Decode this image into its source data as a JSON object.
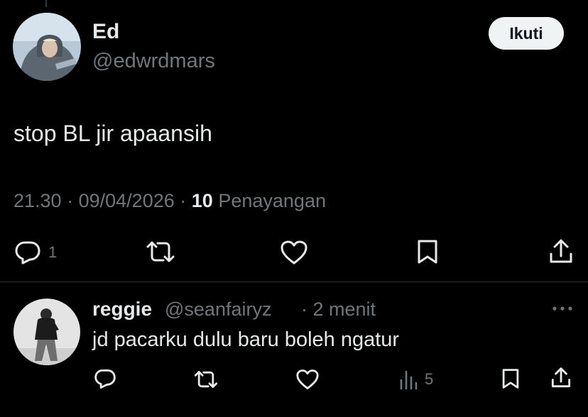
{
  "tweet": {
    "author": {
      "name": "Ed",
      "handle": "@edwrdmars"
    },
    "follow_label": "Ikuti",
    "text": "stop BL jir apaansih",
    "time": "21.30",
    "date": "09/04/2026",
    "separator": "·",
    "view_count": "10",
    "view_label": "Penayangan",
    "stats": {
      "replies": "1"
    },
    "icons": [
      "reply-icon",
      "retweet-icon",
      "like-icon",
      "bookmark-icon",
      "share-icon"
    ]
  },
  "reply": {
    "author": {
      "name": "reggie",
      "handle": "@seanfairyz",
      "time": "· 2 menit"
    },
    "text": "jd pacarku dulu baru boleh ngatur",
    "stats": {
      "views": "5"
    },
    "icons": [
      "reply-icon",
      "retweet-icon",
      "like-icon",
      "views-icon",
      "bookmark-icon",
      "share-icon",
      "more-icon"
    ]
  },
  "colors": {
    "background": "#000000",
    "text": "#e7e9ea",
    "muted": "#71767b",
    "divider": "#2f3336",
    "button": "#eff3f4"
  }
}
